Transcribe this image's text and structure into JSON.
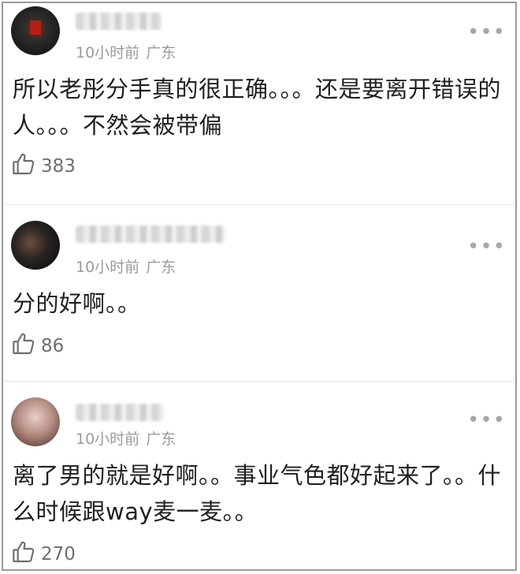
{
  "comments": [
    {
      "time": "10小时前",
      "location": "广东",
      "text": "所以老彤分手真的很正确。。。还是要离开错误的人。。。不然会被带偏",
      "likes": "383"
    },
    {
      "time": "10小时前",
      "location": "广东",
      "text": "分的好啊。。",
      "likes": "86"
    },
    {
      "time": "10小时前",
      "location": "广东",
      "text": "离了男的就是好啊。。事业气色都好起来了。。什么时候跟way麦一麦。。",
      "likes": "270"
    }
  ],
  "icons": {
    "more": "more-dots-icon",
    "like": "thumbs-up-icon"
  },
  "more_glyph": "•••"
}
